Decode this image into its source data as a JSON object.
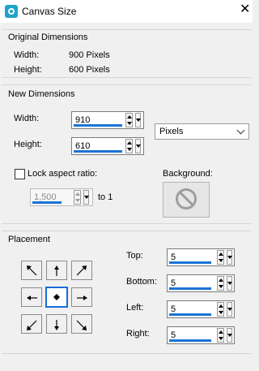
{
  "window": {
    "title": "Canvas Size",
    "close_glyph": "✕"
  },
  "original": {
    "title": "Original Dimensions",
    "width_label": "Width:",
    "width_value": "900 Pixels",
    "height_label": "Height:",
    "height_value": "600 Pixels"
  },
  "new_dims": {
    "title": "New Dimensions",
    "width_label": "Width:",
    "width_value": "910",
    "height_label": "Height:",
    "height_value": "610",
    "units": "Pixels",
    "lock_label": "Lock aspect ratio:",
    "lock_checked": false,
    "ratio_value": "1,500",
    "ratio_suffix": "to 1",
    "background_label": "Background:"
  },
  "placement": {
    "title": "Placement",
    "selected": "center",
    "top_label": "Top:",
    "top_value": "5",
    "bottom_label": "Bottom:",
    "bottom_value": "5",
    "left_label": "Left:",
    "left_value": "5",
    "right_label": "Right:",
    "right_value": "5"
  },
  "colors": {
    "accent": "#1a73d6",
    "app_icon": "#1fa3c9"
  }
}
